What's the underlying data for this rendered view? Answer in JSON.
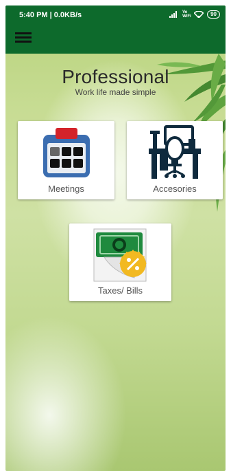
{
  "status_bar": {
    "time": "5:40 PM | 0.0KB/s",
    "wifi_label": "Vo WiFi",
    "battery": "90"
  },
  "header": {
    "title": "Professional",
    "subtitle": "Work life made simple"
  },
  "tiles": [
    {
      "label": "Meetings",
      "icon": "calendar-icon"
    },
    {
      "label": "Accesories",
      "icon": "office-desk-icon"
    },
    {
      "label": "Taxes/ Bills",
      "icon": "money-discount-icon"
    }
  ],
  "colors": {
    "app_bar": "#0d6a2c",
    "background_green": "#c7dc93",
    "calendar_blue": "#3b6db0",
    "calendar_red": "#d3232a",
    "money_green": "#1f8a3e",
    "discount_yellow": "#f2b921"
  }
}
